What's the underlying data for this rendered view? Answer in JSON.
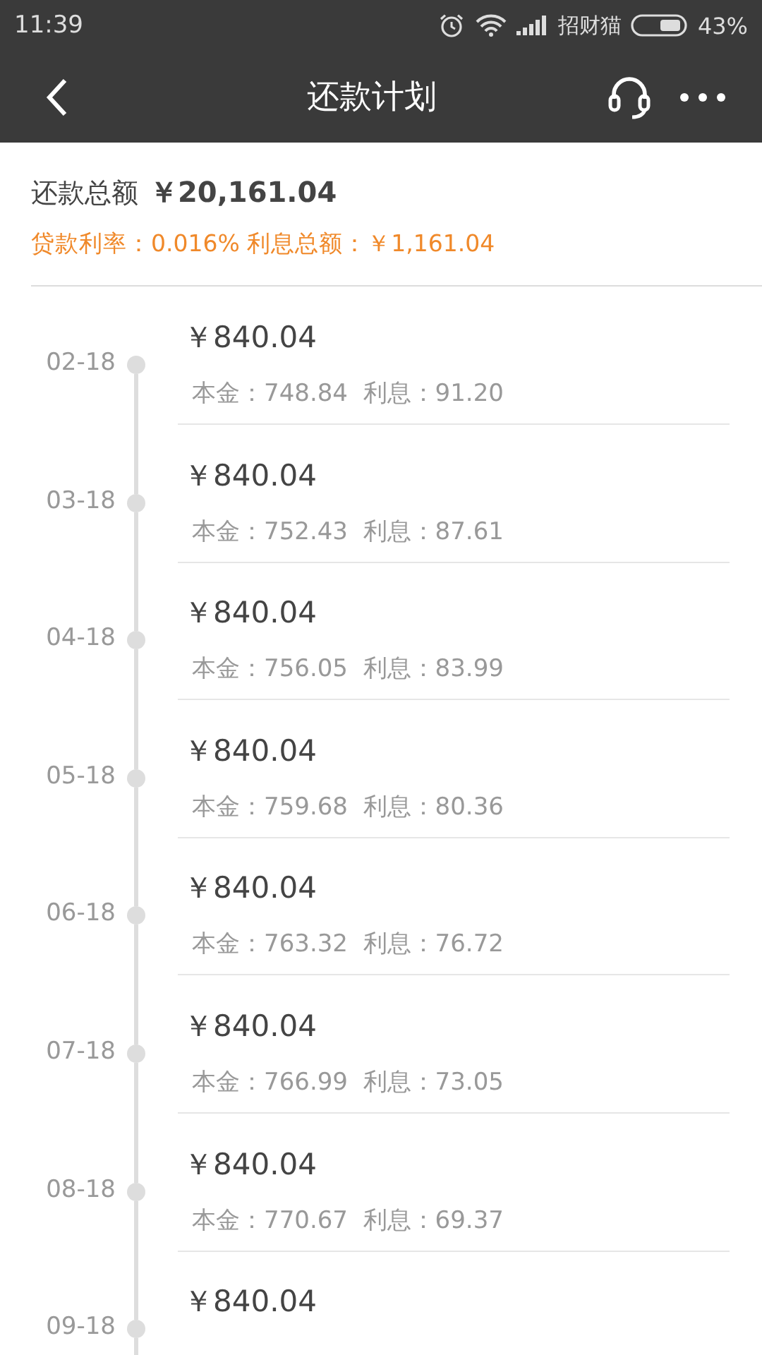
{
  "status_bar": {
    "time": "11:39",
    "carrier": "招财猫",
    "battery": "43%"
  },
  "nav": {
    "title": "还款计划"
  },
  "summary": {
    "total_label": "还款总额",
    "total_value": "￥20,161.04",
    "rate_line": "贷款利率：0.016% 利息总额：￥1,161.04"
  },
  "schedule": [
    {
      "date": "02-18",
      "amount": "￥840.04",
      "detail": "本金：748.84  利息：91.20"
    },
    {
      "date": "03-18",
      "amount": "￥840.04",
      "detail": "本金：752.43  利息：87.61"
    },
    {
      "date": "04-18",
      "amount": "￥840.04",
      "detail": "本金：756.05  利息：83.99"
    },
    {
      "date": "05-18",
      "amount": "￥840.04",
      "detail": "本金：759.68  利息：80.36"
    },
    {
      "date": "06-18",
      "amount": "￥840.04",
      "detail": "本金：763.32  利息：76.72"
    },
    {
      "date": "07-18",
      "amount": "￥840.04",
      "detail": "本金：766.99  利息：73.05"
    },
    {
      "date": "08-18",
      "amount": "￥840.04",
      "detail": "本金：770.67  利息：69.37"
    },
    {
      "date": "09-18",
      "amount": "￥840.04"
    }
  ]
}
